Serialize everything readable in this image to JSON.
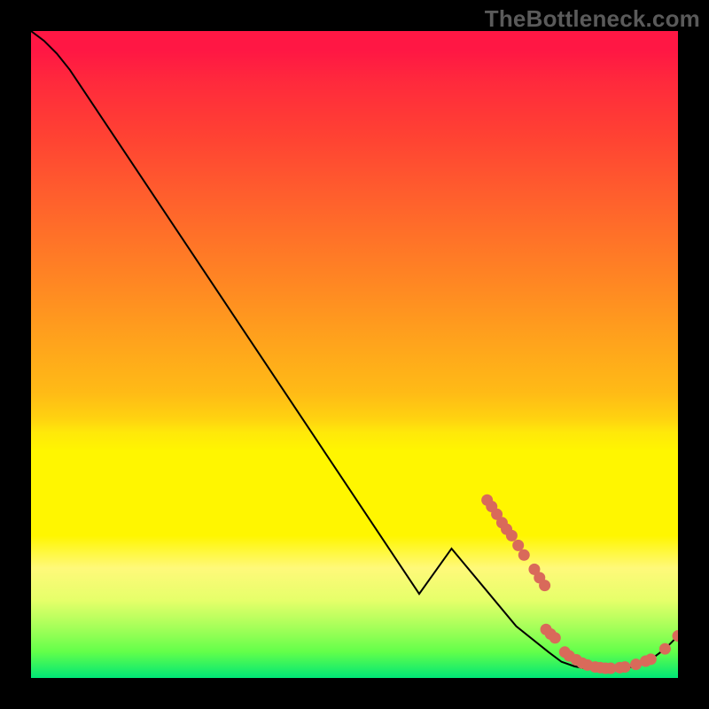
{
  "watermark": "TheBottleneck.com",
  "chart_data": {
    "type": "line",
    "title": "",
    "xlabel": "",
    "ylabel": "",
    "x_range": [
      0,
      100
    ],
    "y_range": [
      0,
      100
    ],
    "curve": [
      {
        "x": 0.0,
        "y": 100.0
      },
      {
        "x": 2.0,
        "y": 98.5
      },
      {
        "x": 4.0,
        "y": 96.5
      },
      {
        "x": 6.0,
        "y": 94.0
      },
      {
        "x": 8.0,
        "y": 91.0
      },
      {
        "x": 10.0,
        "y": 88.0
      },
      {
        "x": 15.0,
        "y": 80.5
      },
      {
        "x": 20.0,
        "y": 73.0
      },
      {
        "x": 25.0,
        "y": 65.5
      },
      {
        "x": 30.0,
        "y": 58.0
      },
      {
        "x": 35.0,
        "y": 50.5
      },
      {
        "x": 40.0,
        "y": 43.0
      },
      {
        "x": 45.0,
        "y": 35.5
      },
      {
        "x": 50.0,
        "y": 28.0
      },
      {
        "x": 55.0,
        "y": 20.5
      },
      {
        "x": 60.0,
        "y": 13.0
      },
      {
        "x": 65.0,
        "y": 20.0
      },
      {
        "x": 70.0,
        "y": 14.0
      },
      {
        "x": 75.0,
        "y": 8.0
      },
      {
        "x": 80.0,
        "y": 4.0
      },
      {
        "x": 82.0,
        "y": 2.5
      },
      {
        "x": 84.0,
        "y": 1.8
      },
      {
        "x": 86.0,
        "y": 1.4
      },
      {
        "x": 88.0,
        "y": 1.3
      },
      {
        "x": 90.0,
        "y": 1.3
      },
      {
        "x": 92.0,
        "y": 1.5
      },
      {
        "x": 94.0,
        "y": 2.0
      },
      {
        "x": 96.0,
        "y": 3.0
      },
      {
        "x": 98.0,
        "y": 4.5
      },
      {
        "x": 100.0,
        "y": 6.5
      }
    ],
    "dot_clusters": [
      {
        "x": 70.5,
        "y": 27.5
      },
      {
        "x": 71.2,
        "y": 26.5
      },
      {
        "x": 72.0,
        "y": 25.3
      },
      {
        "x": 72.8,
        "y": 24.0
      },
      {
        "x": 73.5,
        "y": 23.0
      },
      {
        "x": 74.3,
        "y": 22.0
      },
      {
        "x": 75.3,
        "y": 20.5
      },
      {
        "x": 76.2,
        "y": 19.0
      },
      {
        "x": 77.8,
        "y": 16.8
      },
      {
        "x": 78.6,
        "y": 15.5
      },
      {
        "x": 79.4,
        "y": 14.3
      },
      {
        "x": 79.6,
        "y": 7.5
      },
      {
        "x": 80.3,
        "y": 6.8
      },
      {
        "x": 81.0,
        "y": 6.2
      },
      {
        "x": 82.5,
        "y": 4.0
      },
      {
        "x": 83.2,
        "y": 3.4
      },
      {
        "x": 84.3,
        "y": 2.8
      },
      {
        "x": 85.2,
        "y": 2.3
      },
      {
        "x": 86.0,
        "y": 2.0
      },
      {
        "x": 87.2,
        "y": 1.7
      },
      {
        "x": 88.0,
        "y": 1.6
      },
      {
        "x": 88.8,
        "y": 1.5
      },
      {
        "x": 89.6,
        "y": 1.5
      },
      {
        "x": 91.0,
        "y": 1.6
      },
      {
        "x": 91.8,
        "y": 1.7
      },
      {
        "x": 93.5,
        "y": 2.1
      },
      {
        "x": 95.0,
        "y": 2.6
      },
      {
        "x": 95.8,
        "y": 2.9
      },
      {
        "x": 98.0,
        "y": 4.5
      },
      {
        "x": 100.0,
        "y": 6.5
      }
    ]
  }
}
